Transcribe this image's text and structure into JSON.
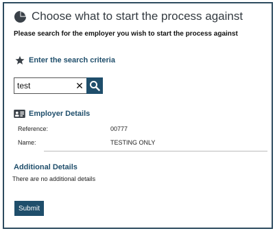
{
  "header": {
    "title": "Choose what to start the process against",
    "icon": "pie-chart-icon",
    "subtitle": "Please search for the employer you wish to start the process against"
  },
  "search": {
    "section_label": "Enter the search criteria",
    "section_icon": "star-icon",
    "value": "test",
    "clear_icon": "close-icon",
    "button_icon": "search-icon"
  },
  "employer": {
    "section_label": "Employer Details",
    "section_icon": "id-card-icon",
    "reference_label": "Reference:",
    "reference_value": "00777",
    "name_label": "Name:",
    "name_value": "TESTING ONLY"
  },
  "additional": {
    "section_label": "Additional Details",
    "text": "There are no additional details"
  },
  "actions": {
    "submit_label": "Submit"
  },
  "colors": {
    "accent": "#1f4e6b",
    "border": "#2c4a5e"
  }
}
